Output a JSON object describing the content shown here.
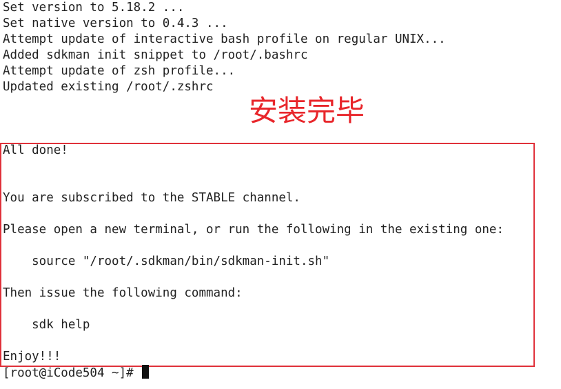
{
  "terminal": {
    "output_lines": [
      "Set version to 5.18.2 ...",
      "Set native version to 0.4.3 ...",
      "Attempt update of interactive bash profile on regular UNIX...",
      "Added sdkman init snippet to /root/.bashrc",
      "Attempt update of zsh profile...",
      "Updated existing /root/.zshrc"
    ],
    "boxed_lines": {
      "all_done": "All done!",
      "subscribed": "You are subscribed to the STABLE channel.",
      "please_open": "Please open a new terminal, or run the following in the existing one:",
      "source_cmd": "    source \"/root/.sdkman/bin/sdkman-init.sh\"",
      "then_issue": "Then issue the following command:",
      "sdk_help": "    sdk help",
      "enjoy": "Enjoy!!!"
    },
    "prompt": "[root@iCode504 ~]# "
  },
  "annotation": {
    "label": "安装完毕",
    "color": "#e8262b"
  }
}
